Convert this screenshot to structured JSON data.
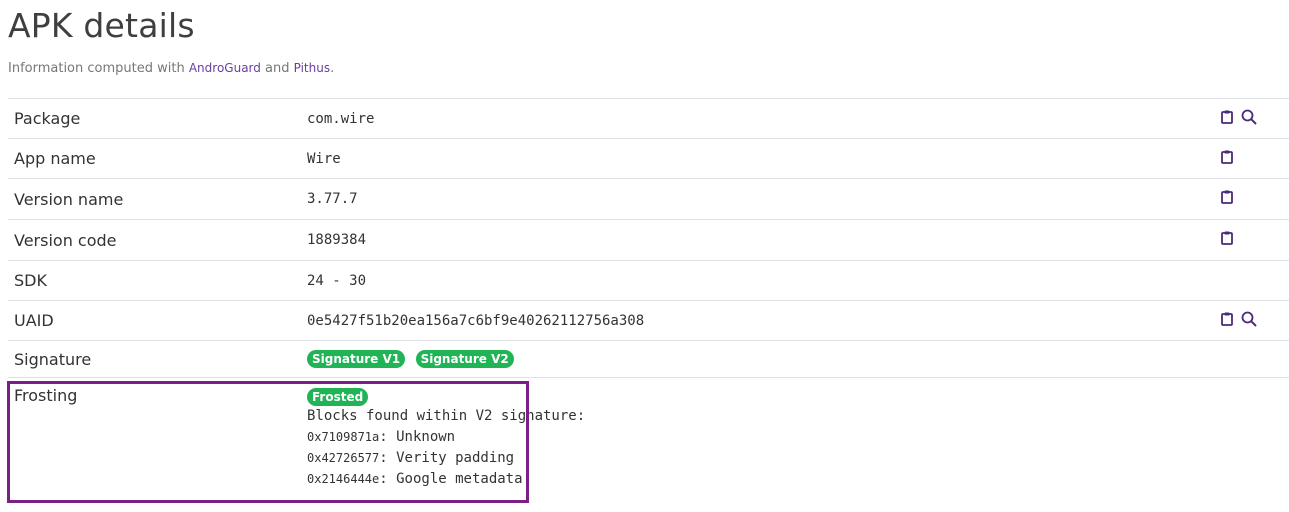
{
  "header": {
    "title": "APK details",
    "subtitle_prefix": "Information computed with ",
    "link1": "AndroGuard",
    "subtitle_mid": " and ",
    "link2": "Pithus",
    "subtitle_suffix": "."
  },
  "rows": [
    {
      "label": "Package",
      "value": "com.wire",
      "icons": [
        "clipboard-icon",
        "search-icon"
      ]
    },
    {
      "label": "App name",
      "value": "Wire",
      "icons": [
        "clipboard-icon"
      ]
    },
    {
      "label": "Version name",
      "value": "3.77.7",
      "icons": [
        "clipboard-icon"
      ]
    },
    {
      "label": "Version code",
      "value": "1889384",
      "icons": [
        "clipboard-icon"
      ]
    },
    {
      "label": "SDK",
      "value": "24 - 30",
      "icons": []
    },
    {
      "label": "UAID",
      "value": "0e5427f51b20ea156a7c6bf9e40262112756a308",
      "icons": [
        "clipboard-icon",
        "search-icon"
      ]
    }
  ],
  "signature": {
    "label": "Signature",
    "badges": [
      "Signature V1",
      "Signature V2"
    ]
  },
  "frosting": {
    "label": "Frosting",
    "badge": "Frosted",
    "heading": "Blocks found within V2 signature:",
    "blocks": [
      {
        "id": "0x7109871a",
        "desc": ": Unknown"
      },
      {
        "id": "0x42726577",
        "desc": ": Verity padding"
      },
      {
        "id": "0x2146444e",
        "desc": ": Google metadata"
      }
    ]
  },
  "colors": {
    "accent": "#6a3f9f",
    "badge": "#20b457",
    "highlight": "#7b1f86"
  }
}
